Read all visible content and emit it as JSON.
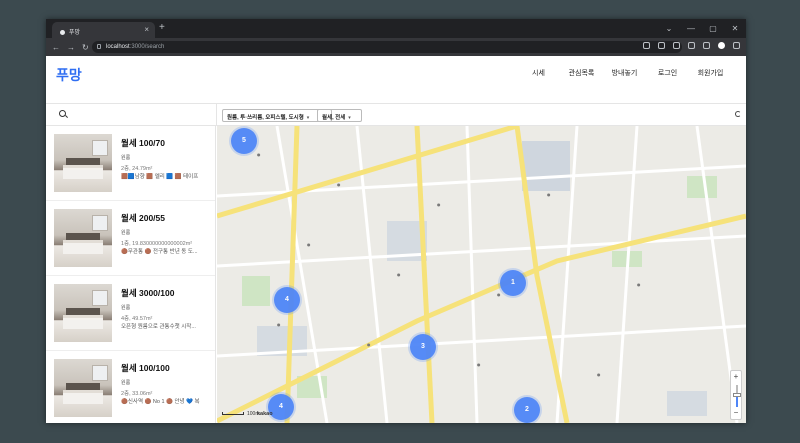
{
  "browser": {
    "tab_title": "푸망",
    "url_host": "localhost",
    "url_path": ":3000/search",
    "new_tab": "+",
    "tab_close": "×",
    "win_minimize": "—",
    "win_maximize": "▢",
    "win_close": "✕",
    "win_chevron": "⌄"
  },
  "header": {
    "logo": "푸망",
    "menu": [
      "시세",
      "관심목록",
      "방내놓기",
      "로그인",
      "회원가입"
    ]
  },
  "filters": {
    "room_type": "원룸, 투·쓰리룸, 오피스텔, 도시형",
    "deal_type": "월세, 전세"
  },
  "listings": [
    {
      "title": "월세 100/70",
      "type": "원룸",
      "meta": "2층, 24.79m²",
      "tags": "🟫🟦남향 🟫 엘리 🟦 🟫 테이프"
    },
    {
      "title": "월세 200/55",
      "type": "원룸",
      "meta": "1층, 19.830000000000002m²",
      "tags": "🟤무관통 🟤 전구통 반년 동 도..."
    },
    {
      "title": "월세 3000/100",
      "type": "원룸",
      "meta": "4층, 49.57m²",
      "tags": "오픈형 원룸으로 관통수챗 시작..."
    },
    {
      "title": "월세 100/100",
      "type": "원룸",
      "meta": "2층, 33.06m²",
      "tags": "🟤신사역 🟤 No 1 🟤 안녕 💙 복"
    }
  ],
  "map": {
    "clusters": [
      "5",
      "1",
      "4",
      "3",
      "4",
      "2"
    ],
    "scale": "100m",
    "provider": "kakao",
    "zoom_in": "+",
    "zoom_out": "−"
  },
  "colors": {
    "accent": "#2f6ef2",
    "cluster": "#4f86f7",
    "road_major": "#f6e27a"
  }
}
